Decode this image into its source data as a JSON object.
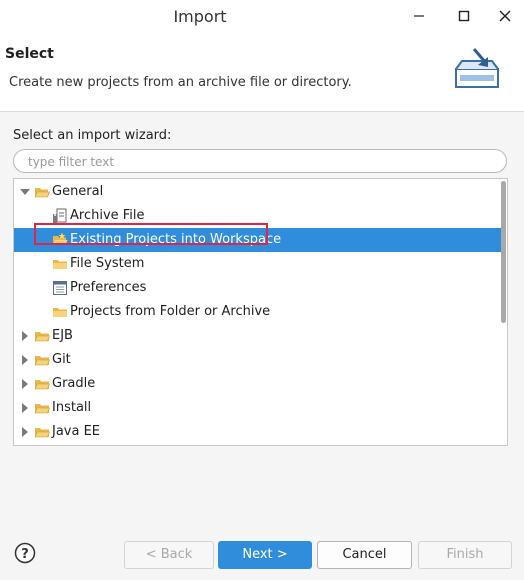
{
  "window": {
    "title": "Import"
  },
  "header": {
    "title": "Select",
    "description": "Create new projects from an archive file or directory."
  },
  "wizard": {
    "label": "Select an import wizard:",
    "filter_placeholder": "type filter text"
  },
  "tree": {
    "items": [
      {
        "label": "General",
        "icon": "folder-open-icon",
        "expanded": true,
        "level": 0
      },
      {
        "label": "Archive File",
        "icon": "archive-file-icon",
        "level": 1
      },
      {
        "label": "Existing Projects into Workspace",
        "icon": "project-folder-icon",
        "level": 1,
        "selected": true
      },
      {
        "label": "File System",
        "icon": "folder-icon",
        "level": 1
      },
      {
        "label": "Preferences",
        "icon": "preferences-icon",
        "level": 1
      },
      {
        "label": "Projects from Folder or Archive",
        "icon": "folder-icon",
        "level": 1
      },
      {
        "label": "EJB",
        "icon": "folder-icon",
        "expanded": false,
        "level": 0
      },
      {
        "label": "Git",
        "icon": "folder-icon",
        "expanded": false,
        "level": 0
      },
      {
        "label": "Gradle",
        "icon": "folder-icon",
        "expanded": false,
        "level": 0
      },
      {
        "label": "Install",
        "icon": "folder-icon",
        "expanded": false,
        "level": 0
      },
      {
        "label": "Java EE",
        "icon": "folder-icon",
        "expanded": false,
        "level": 0
      }
    ]
  },
  "buttons": {
    "back": "< Back",
    "next": "Next >",
    "cancel": "Cancel",
    "finish": "Finish"
  },
  "colors": {
    "selection": "#2f8ddb",
    "highlight_box": "#e0244a",
    "folder": "#e8b84a"
  }
}
